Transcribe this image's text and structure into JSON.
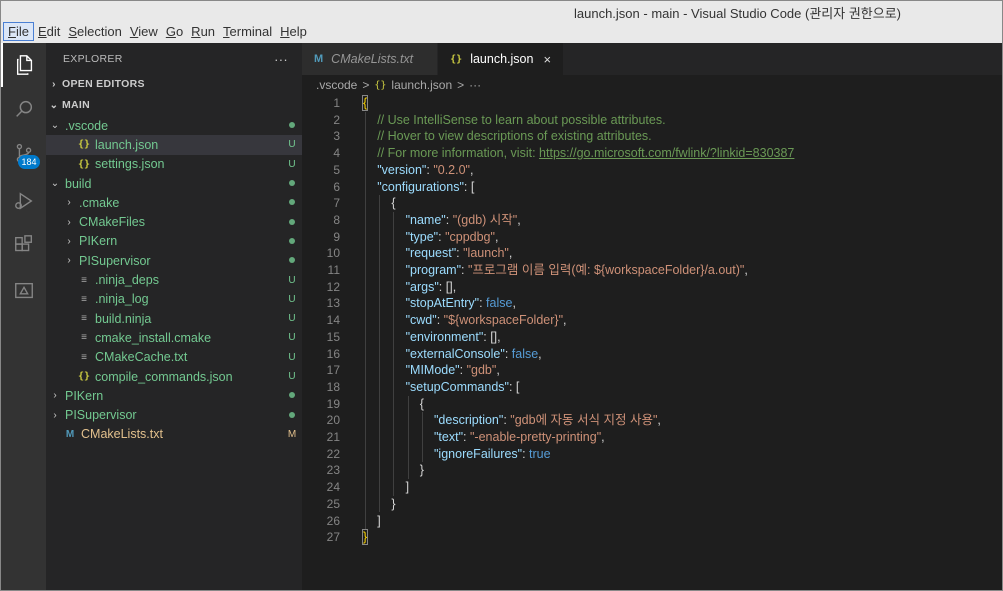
{
  "window": {
    "title": "launch.json - main - Visual Studio Code (관리자 권한으로)"
  },
  "menu": [
    {
      "label": "File",
      "acc": "F",
      "rest": "ile"
    },
    {
      "label": "Edit",
      "acc": "E",
      "rest": "dit"
    },
    {
      "label": "Selection",
      "acc": "S",
      "rest": "election"
    },
    {
      "label": "View",
      "acc": "V",
      "rest": "iew"
    },
    {
      "label": "Go",
      "acc": "G",
      "rest": "o"
    },
    {
      "label": "Run",
      "acc": "R",
      "rest": "un"
    },
    {
      "label": "Terminal",
      "acc": "T",
      "rest": "erminal"
    },
    {
      "label": "Help",
      "acc": "H",
      "rest": "elp"
    }
  ],
  "activity": {
    "scm_badge": "184"
  },
  "sidebar": {
    "title": "EXPLORER",
    "more": "···",
    "open_editors": "OPEN EDITORS",
    "workspace": "MAIN",
    "tree": [
      {
        "indent": 1,
        "chev": "⌄",
        "icon": "",
        "name": ".vscode",
        "status": "dot",
        "color": "green"
      },
      {
        "indent": 2,
        "chev": "",
        "icon": "{}",
        "name": "launch.json",
        "status": "U",
        "color": "green",
        "selected": true
      },
      {
        "indent": 2,
        "chev": "",
        "icon": "{}",
        "name": "settings.json",
        "status": "U",
        "color": "green"
      },
      {
        "indent": 1,
        "chev": "⌄",
        "icon": "",
        "name": "build",
        "status": "dot",
        "color": "green"
      },
      {
        "indent": 2,
        "chev": "›",
        "icon": "",
        "name": ".cmake",
        "status": "dot",
        "color": "green"
      },
      {
        "indent": 2,
        "chev": "›",
        "icon": "",
        "name": "CMakeFiles",
        "status": "dot",
        "color": "green"
      },
      {
        "indent": 2,
        "chev": "›",
        "icon": "",
        "name": "PIKern",
        "status": "dot",
        "color": "green"
      },
      {
        "indent": 2,
        "chev": "›",
        "icon": "",
        "name": "PISupervisor",
        "status": "dot",
        "color": "green"
      },
      {
        "indent": 2,
        "chev": "",
        "icon": "≡",
        "name": ".ninja_deps",
        "status": "U",
        "color": "green"
      },
      {
        "indent": 2,
        "chev": "",
        "icon": "≡",
        "name": ".ninja_log",
        "status": "U",
        "color": "green"
      },
      {
        "indent": 2,
        "chev": "",
        "icon": "≡",
        "name": "build.ninja",
        "status": "U",
        "color": "green"
      },
      {
        "indent": 2,
        "chev": "",
        "icon": "≡",
        "name": "cmake_install.cmake",
        "status": "U",
        "color": "green"
      },
      {
        "indent": 2,
        "chev": "",
        "icon": "≡",
        "name": "CMakeCache.txt",
        "status": "U",
        "color": "green"
      },
      {
        "indent": 2,
        "chev": "",
        "icon": "{}",
        "name": "compile_commands.json",
        "status": "U",
        "color": "green"
      },
      {
        "indent": 1,
        "chev": "›",
        "icon": "",
        "name": "PIKern",
        "status": "dot",
        "color": "green"
      },
      {
        "indent": 1,
        "chev": "›",
        "icon": "",
        "name": "PISupervisor",
        "status": "dot",
        "color": "green"
      },
      {
        "indent": 1,
        "chev": "",
        "icon": "M",
        "name": "CMakeLists.txt",
        "status": "M",
        "color": "mod"
      }
    ]
  },
  "tabs": [
    {
      "icon": "M",
      "label": "CMakeLists.txt",
      "active": false
    },
    {
      "icon": "{}",
      "label": "launch.json",
      "active": true,
      "close": "×"
    }
  ],
  "breadcrumbs": [
    ".vscode",
    ">",
    "{}",
    "launch.json",
    ">",
    "···"
  ],
  "code": [
    {
      "n": "1",
      "indent": 0,
      "tokens": [
        [
          "br1",
          "{"
        ]
      ]
    },
    {
      "n": "2",
      "indent": 1,
      "tokens": [
        [
          "c",
          "// Use IntelliSense to learn about possible attributes."
        ]
      ]
    },
    {
      "n": "3",
      "indent": 1,
      "tokens": [
        [
          "c",
          "// Hover to view descriptions of existing attributes."
        ]
      ]
    },
    {
      "n": "4",
      "indent": 1,
      "tokens": [
        [
          "c",
          "// For more information, visit: "
        ],
        [
          "u",
          "https://go.microsoft.com/fwlink/?linkid=830387"
        ]
      ]
    },
    {
      "n": "5",
      "indent": 1,
      "tokens": [
        [
          "k",
          "\"version\""
        ],
        [
          "p",
          ": "
        ],
        [
          "s",
          "\"0.2.0\""
        ],
        [
          "p",
          ","
        ]
      ]
    },
    {
      "n": "6",
      "indent": 1,
      "tokens": [
        [
          "k",
          "\"configurations\""
        ],
        [
          "p",
          ": ["
        ]
      ]
    },
    {
      "n": "7",
      "indent": 2,
      "tokens": [
        [
          "p",
          "{"
        ]
      ]
    },
    {
      "n": "8",
      "indent": 3,
      "tokens": [
        [
          "k",
          "\"name\""
        ],
        [
          "p",
          ": "
        ],
        [
          "s",
          "\"(gdb) 시작\""
        ],
        [
          "p",
          ","
        ]
      ]
    },
    {
      "n": "9",
      "indent": 3,
      "tokens": [
        [
          "k",
          "\"type\""
        ],
        [
          "p",
          ": "
        ],
        [
          "s",
          "\"cppdbg\""
        ],
        [
          "p",
          ","
        ]
      ]
    },
    {
      "n": "10",
      "indent": 3,
      "tokens": [
        [
          "k",
          "\"request\""
        ],
        [
          "p",
          ": "
        ],
        [
          "s",
          "\"launch\""
        ],
        [
          "p",
          ","
        ]
      ]
    },
    {
      "n": "11",
      "indent": 3,
      "tokens": [
        [
          "k",
          "\"program\""
        ],
        [
          "p",
          ": "
        ],
        [
          "s",
          "\"프로그램 이름 입력(예: ${workspaceFolder}/a.out)\""
        ],
        [
          "p",
          ","
        ]
      ]
    },
    {
      "n": "12",
      "indent": 3,
      "tokens": [
        [
          "k",
          "\"args\""
        ],
        [
          "p",
          ": [],"
        ]
      ]
    },
    {
      "n": "13",
      "indent": 3,
      "tokens": [
        [
          "k",
          "\"stopAtEntry\""
        ],
        [
          "p",
          ": "
        ],
        [
          "b",
          "false"
        ],
        [
          "p",
          ","
        ]
      ]
    },
    {
      "n": "14",
      "indent": 3,
      "tokens": [
        [
          "k",
          "\"cwd\""
        ],
        [
          "p",
          ": "
        ],
        [
          "s",
          "\"${workspaceFolder}\""
        ],
        [
          "p",
          ","
        ]
      ]
    },
    {
      "n": "15",
      "indent": 3,
      "tokens": [
        [
          "k",
          "\"environment\""
        ],
        [
          "p",
          ": [],"
        ]
      ]
    },
    {
      "n": "16",
      "indent": 3,
      "tokens": [
        [
          "k",
          "\"externalConsole\""
        ],
        [
          "p",
          ": "
        ],
        [
          "b",
          "false"
        ],
        [
          "p",
          ","
        ]
      ]
    },
    {
      "n": "17",
      "indent": 3,
      "tokens": [
        [
          "k",
          "\"MIMode\""
        ],
        [
          "p",
          ": "
        ],
        [
          "s",
          "\"gdb\""
        ],
        [
          "p",
          ","
        ]
      ]
    },
    {
      "n": "18",
      "indent": 3,
      "tokens": [
        [
          "k",
          "\"setupCommands\""
        ],
        [
          "p",
          ": ["
        ]
      ]
    },
    {
      "n": "19",
      "indent": 4,
      "tokens": [
        [
          "p",
          "{"
        ]
      ]
    },
    {
      "n": "20",
      "indent": 5,
      "tokens": [
        [
          "k",
          "\"description\""
        ],
        [
          "p",
          ": "
        ],
        [
          "s",
          "\"gdb에 자동 서식 지정 사용\""
        ],
        [
          "p",
          ","
        ]
      ]
    },
    {
      "n": "21",
      "indent": 5,
      "tokens": [
        [
          "k",
          "\"text\""
        ],
        [
          "p",
          ": "
        ],
        [
          "s",
          "\"-enable-pretty-printing\""
        ],
        [
          "p",
          ","
        ]
      ]
    },
    {
      "n": "22",
      "indent": 5,
      "tokens": [
        [
          "k",
          "\"ignoreFailures\""
        ],
        [
          "p",
          ": "
        ],
        [
          "b",
          "true"
        ]
      ]
    },
    {
      "n": "23",
      "indent": 4,
      "tokens": [
        [
          "p",
          "}"
        ]
      ]
    },
    {
      "n": "24",
      "indent": 3,
      "tokens": [
        [
          "p",
          "]"
        ]
      ]
    },
    {
      "n": "25",
      "indent": 2,
      "tokens": [
        [
          "p",
          "}"
        ]
      ]
    },
    {
      "n": "26",
      "indent": 1,
      "tokens": [
        [
          "p",
          "]"
        ]
      ]
    },
    {
      "n": "27",
      "indent": 0,
      "tokens": [
        [
          "br1",
          "}"
        ]
      ]
    }
  ]
}
